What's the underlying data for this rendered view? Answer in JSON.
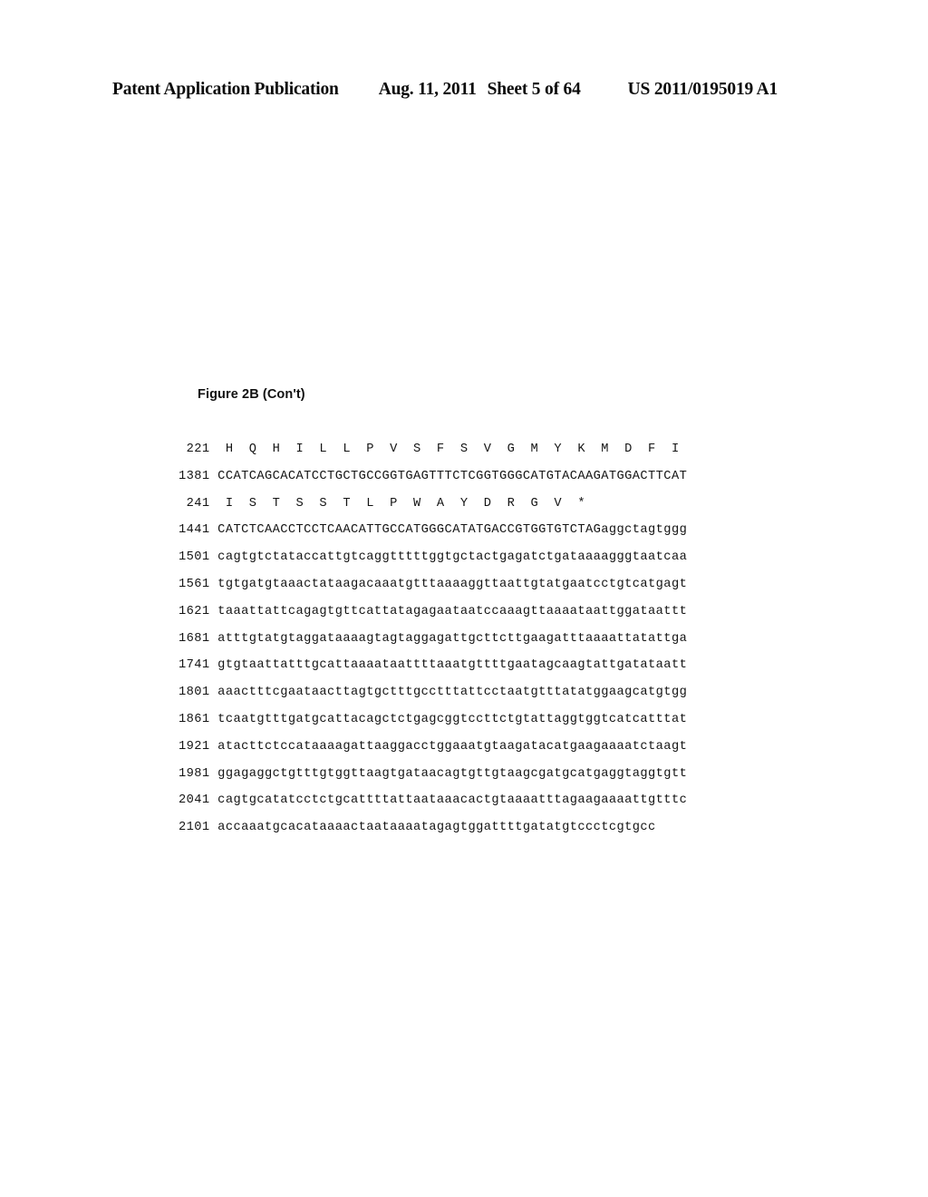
{
  "header": {
    "publication": "Patent Application Publication",
    "date": "Aug. 11, 2011",
    "sheet": "Sheet 5 of 64",
    "patent_number": "US 2011/0195019 A1"
  },
  "figure": {
    "caption": "Figure 2B (Con't)"
  },
  "sequence": {
    "lines": [
      {
        "number": " 221",
        "type": "protein",
        "text": " H  Q  H  I  L  L  P  V  S  F  S  V  G  M  Y  K  M  D  F  I"
      },
      {
        "number": "1381",
        "type": "dna",
        "text": "CCATCAGCACATCCTGCTGCCGGTGAGTTTCTCGGTGGGCATGTACAAGATGGACTTCAT"
      },
      {
        "number": " 241",
        "type": "protein",
        "text": " I  S  T  S  S  T  L  P  W  A  Y  D  R  G  V  *"
      },
      {
        "number": "1441",
        "type": "dna",
        "text": "CATCTCAACCTCCTCAACATTGCCATGGGCATATGACCGTGGTGTCTAGaggctagtggg"
      },
      {
        "number": "1501",
        "type": "dna",
        "text": "cagtgtctataccattgtcaggtttttggtgctactgagatctgataaaagggtaatcaa"
      },
      {
        "number": "1561",
        "type": "dna",
        "text": "tgtgatgtaaactataagacaaatgtttaaaaggttaattgtatgaatcctgtcatgagt"
      },
      {
        "number": "1621",
        "type": "dna",
        "text": "taaattattcagagtgttcattatagagaataatccaaagttaaaataattggataattt"
      },
      {
        "number": "1681",
        "type": "dna",
        "text": "atttgtatgtaggataaaagtagtaggagattgcttcttgaagatttaaaattatattga"
      },
      {
        "number": "1741",
        "type": "dna",
        "text": "gtgtaattatttgcattaaaataattttaaatgttttgaatagcaagtattgatataatt"
      },
      {
        "number": "1801",
        "type": "dna",
        "text": "aaactttcgaataacttagtgctttgcctttattcctaatgtttatatggaagcatgtgg"
      },
      {
        "number": "1861",
        "type": "dna",
        "text": "tcaatgtttgatgcattacagctctgagcggtccttctgtattaggtggtcatcatttat"
      },
      {
        "number": "1921",
        "type": "dna",
        "text": "atacttctccataaaagattaaggacctggaaatgtaagatacatgaagaaaatctaagt"
      },
      {
        "number": "1981",
        "type": "dna",
        "text": "ggagaggctgtttgtggttaagtgataacagtgttgtaagcgatgcatgaggtaggtgtt"
      },
      {
        "number": "2041",
        "type": "dna",
        "text": "cagtgcatatcctctgcattttattaataaacactgtaaaatttagaagaaaattgtttc"
      },
      {
        "number": "2101",
        "type": "dna",
        "text": "accaaatgcacataaaactaataaaatagagtggattttgatatgtccctcgtgcc"
      }
    ]
  }
}
